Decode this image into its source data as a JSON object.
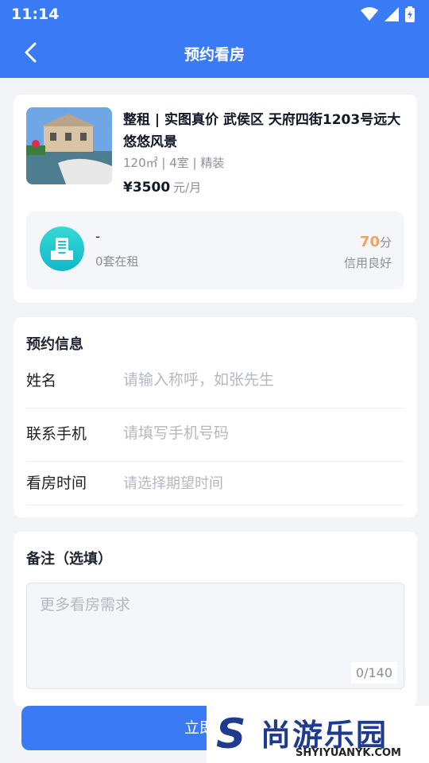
{
  "status_bar": {
    "time": "11:14"
  },
  "header": {
    "title": "预约看房"
  },
  "listing": {
    "title": "整租 | 实图真价 武侯区 天府四街1203号远大悠悠风景",
    "spec": "120㎡ | 4室 | 精装",
    "price": "¥3500",
    "price_unit": "元/月"
  },
  "landlord": {
    "name": "-",
    "listings_count": "0套在租",
    "score_value": "70",
    "score_unit": "分",
    "credit_text": "信用良好"
  },
  "appointment": {
    "section_title": "预约信息",
    "fields": [
      {
        "label": "姓名",
        "placeholder": "请输入称呼，如张先生"
      },
      {
        "label": "联系手机",
        "placeholder": "请填写手机号码"
      },
      {
        "label": "看房时间",
        "placeholder": "请选择期望时间"
      }
    ]
  },
  "remarks": {
    "section_title": "备注（选填）",
    "placeholder": "更多看房需求",
    "counter": "0/140"
  },
  "submit": {
    "label": "立即预约"
  },
  "watermark": {
    "brand": "尚游乐园",
    "url": "SHYIYUANYK.COM",
    "letter": "S"
  },
  "colors": {
    "primary": "#3a7af5",
    "score": "#f2a35b",
    "teal": "#12b8c8"
  }
}
